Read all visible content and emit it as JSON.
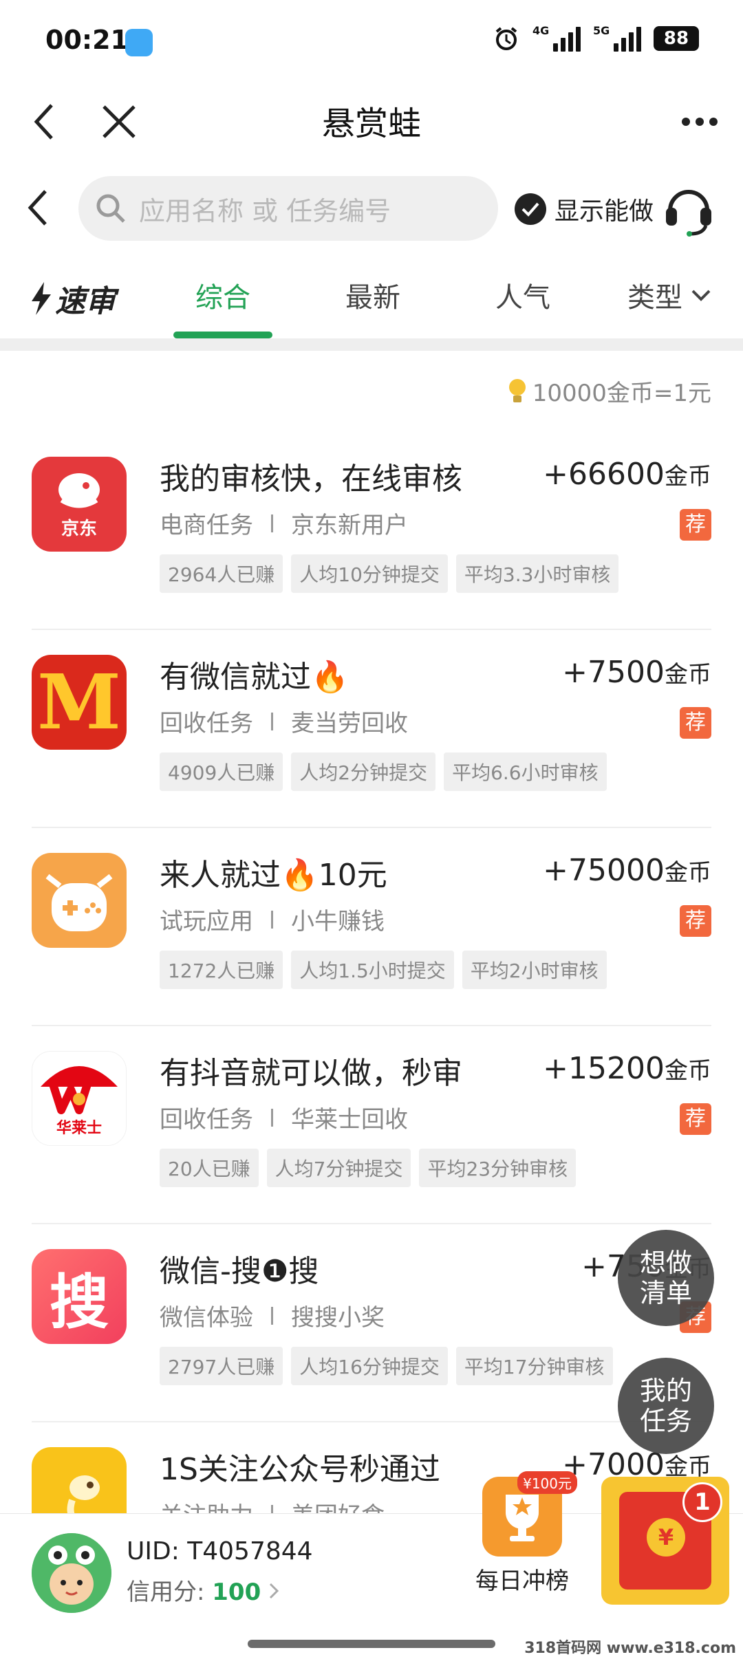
{
  "status": {
    "time": "00:21",
    "net1": "4G",
    "net2": "5G",
    "battery": "88"
  },
  "nav": {
    "title": "悬赏蛙"
  },
  "search": {
    "placeholder": "应用名称 或 任务编号",
    "show_can_do": "显示能做"
  },
  "tabs": {
    "suwen": "速审",
    "items": [
      "综合",
      "最新",
      "人气",
      "类型"
    ],
    "active": 0
  },
  "ratio": "10000金币=1元",
  "reward_unit": "金币",
  "rec_label": "荐",
  "tasks": [
    {
      "title": "我的审核快，在线审核",
      "reward": "+66600",
      "category": "电商任务",
      "app": "京东新用户",
      "tags": [
        "2964人已赚",
        "人均10分钟提交",
        "平均3.3小时审核"
      ],
      "icon": "jd-icon",
      "icon_text": "京东"
    },
    {
      "title": "有微信就过🔥",
      "reward": "+7500",
      "category": "回收任务",
      "app": "麦当劳回收",
      "tags": [
        "4909人已赚",
        "人均2分钟提交",
        "平均6.6小时审核"
      ],
      "icon": "mcdonalds-icon",
      "icon_text": "M"
    },
    {
      "title": "来人就过🔥10元",
      "reward": "+75000",
      "category": "试玩应用",
      "app": "小牛赚钱",
      "tags": [
        "1272人已赚",
        "人均1.5小时提交",
        "平均2小时审核"
      ],
      "icon": "cow-icon",
      "icon_text": ""
    },
    {
      "title": "有抖音就可以做，秒审",
      "reward": "+15200",
      "category": "回收任务",
      "app": "华莱士回收",
      "tags": [
        "20人已赚",
        "人均7分钟提交",
        "平均23分钟审核"
      ],
      "icon": "wallace-icon",
      "icon_text": "华莱士"
    },
    {
      "title": "微信-搜❶搜",
      "reward": "+750",
      "category": "微信体验",
      "app": "搜搜小奖",
      "tags": [
        "2797人已赚",
        "人均16分钟提交",
        "平均17分钟审核"
      ],
      "icon": "sousou-icon",
      "icon_text": "搜"
    },
    {
      "title": "1S关注公众号秒通过",
      "reward": "+7000",
      "category": "关注助力",
      "app": "美团好食",
      "tags": [],
      "icon": "kangaroo-icon",
      "icon_text": ""
    }
  ],
  "float": {
    "wish_list": "想做清单",
    "my_tasks": "我的任务"
  },
  "bottom": {
    "uid": "UID: T4057844",
    "credit_label": "信用分: ",
    "credit_value": "100",
    "daily_rank": "每日冲榜",
    "daily_badge": "¥100元",
    "redpacket_count": "1",
    "redpacket_symbol": "¥"
  },
  "watermark": "318首码网 www.e318.com",
  "colors": {
    "accent": "#22a255",
    "rec": "#f2683e",
    "jd": "#e4393c",
    "mcd": "#da291c",
    "cow": "#f6a54a",
    "wallace": "#e30613",
    "sousou": "#f25a5a",
    "kangaroo": "#f9c31a"
  }
}
